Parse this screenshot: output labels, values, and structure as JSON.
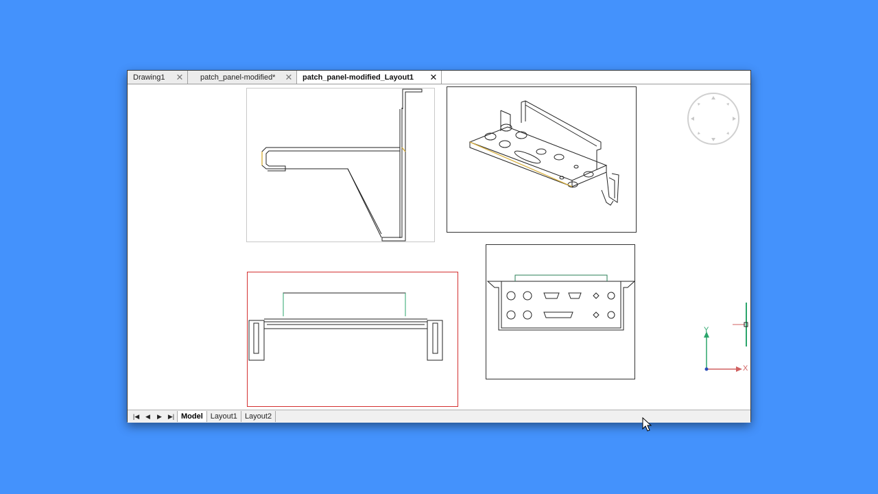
{
  "document_tabs": [
    {
      "label": "Drawing1",
      "active": false
    },
    {
      "label": "patch_panel-modified*",
      "active": false
    },
    {
      "label": "patch_panel-modified_Layout1",
      "active": true
    }
  ],
  "layout_tabs": [
    "Model",
    "Layout1",
    "Layout2"
  ],
  "active_layout": "Model",
  "nav_buttons": [
    "first-icon",
    "previous-icon",
    "next-icon",
    "last-icon"
  ],
  "ucs": {
    "x_label": "X",
    "y_label": "Y"
  },
  "colors": {
    "background": "#4492fc",
    "active_viewport_border": "#d32f2f",
    "ucs_x_axis": "#d06060",
    "ucs_y_axis": "#2aa56b",
    "highlight_edge": "#d8b040"
  }
}
